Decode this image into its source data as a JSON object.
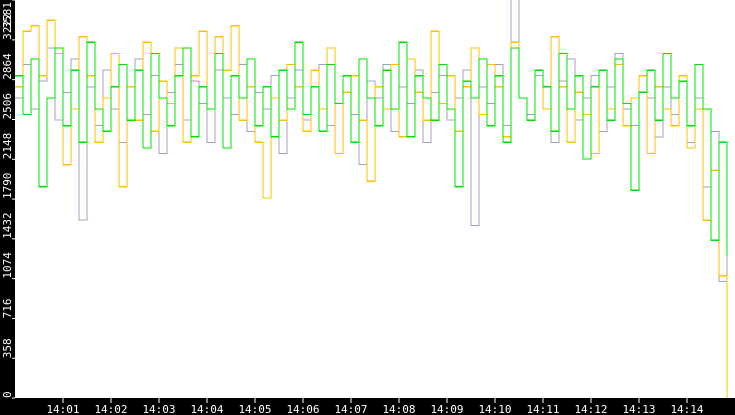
{
  "chart_data": {
    "type": "line",
    "title": "",
    "xlabel": "",
    "ylabel": "",
    "ylim": [
      0,
      3581
    ],
    "xlim_minutes": [
      0,
      15
    ],
    "y_ticks": [
      "0",
      "358",
      "716",
      "1074",
      "1432",
      "1790",
      "2148",
      "2506",
      "2864",
      "3222",
      "3581"
    ],
    "x_ticks": [
      "14:01",
      "14:02",
      "14:03",
      "14:04",
      "14:05",
      "14:06",
      "14:07",
      "14:08",
      "14:09",
      "14:10",
      "14:11",
      "14:12",
      "14:13",
      "14:14"
    ],
    "x_step_seconds": 10,
    "series": [
      {
        "name": "green",
        "color": "#00e000",
        "values": [
          2900,
          2550,
          3050,
          1900,
          2700,
          3150,
          2450,
          2950,
          2300,
          3200,
          2600,
          2400,
          2800,
          3000,
          2500,
          2950,
          2250,
          3100,
          2700,
          2450,
          2900,
          3150,
          2350,
          2800,
          2600,
          3100,
          2250,
          2900,
          2700,
          3050,
          2450,
          2800,
          2350,
          2950,
          2600,
          3200,
          2550,
          2800,
          2400,
          3000,
          2650,
          2900,
          2300,
          3050,
          2700,
          2450,
          2950,
          2600,
          3200,
          2350,
          2900,
          2700,
          2500,
          3000,
          2600,
          1900,
          2850,
          2700,
          3050,
          2450,
          2900,
          2300,
          3150,
          2700,
          2500,
          2950,
          2800,
          2400,
          3100,
          2600,
          2900,
          2150,
          2800,
          2950,
          2500,
          3050,
          2650,
          1870,
          2750,
          2950,
          2500,
          3100,
          2700,
          2850,
          2450,
          3000,
          2600,
          1420,
          2300,
          1280
        ]
      },
      {
        "name": "orange",
        "color": "#ffc000",
        "values": [
          2800,
          3300,
          3350,
          2900,
          3400,
          3100,
          2100,
          2600,
          3250,
          2900,
          2300,
          2700,
          3100,
          1900,
          2800,
          2500,
          3200,
          2400,
          2850,
          2650,
          3150,
          2300,
          2900,
          3300,
          2600,
          3250,
          2950,
          3350,
          2500,
          2800,
          2300,
          1800,
          2700,
          2500,
          3000,
          2800,
          2400,
          2950,
          2600,
          3150,
          2200,
          2750,
          2900,
          2500,
          1950,
          2800,
          2600,
          3000,
          2350,
          3050,
          2750,
          2500,
          3300,
          2650,
          2900,
          2400,
          2800,
          3150,
          2550,
          3000,
          2800,
          2350,
          3200,
          2700,
          2500,
          2950,
          2600,
          3250,
          2800,
          2300,
          2750,
          2550,
          2200,
          2950,
          2600,
          3000,
          2450,
          2700,
          2900,
          2200,
          2800,
          2600,
          2450,
          2900,
          2250,
          2600,
          1600,
          2050,
          1100,
          0
        ]
      },
      {
        "name": "gray",
        "color": "#a0a0c0",
        "values": [
          2700,
          3000,
          2600,
          2850,
          3150,
          2500,
          2750,
          3050,
          1600,
          2800,
          2450,
          2950,
          2600,
          2300,
          2800,
          3050,
          2550,
          2900,
          2200,
          2750,
          3000,
          2500,
          2850,
          2650,
          2300,
          2950,
          2700,
          2550,
          3000,
          2400,
          2750,
          2600,
          2900,
          2200,
          2700,
          2950,
          2500,
          2800,
          3000,
          2450,
          2650,
          2900,
          2550,
          2100,
          2850,
          2700,
          3000,
          2400,
          2800,
          2650,
          2950,
          2300,
          2750,
          2900,
          2500,
          2700,
          2950,
          1550,
          2800,
          2650,
          3000,
          2450,
          3600,
          2700,
          2550,
          2900,
          2600,
          2300,
          2850,
          3050,
          2500,
          2700,
          2900,
          2400,
          2800,
          3100,
          2600,
          2450,
          2900,
          2700,
          2350,
          2800,
          2550,
          2900,
          2300,
          2700,
          1900,
          2400,
          1050,
          2200
        ]
      }
    ]
  }
}
